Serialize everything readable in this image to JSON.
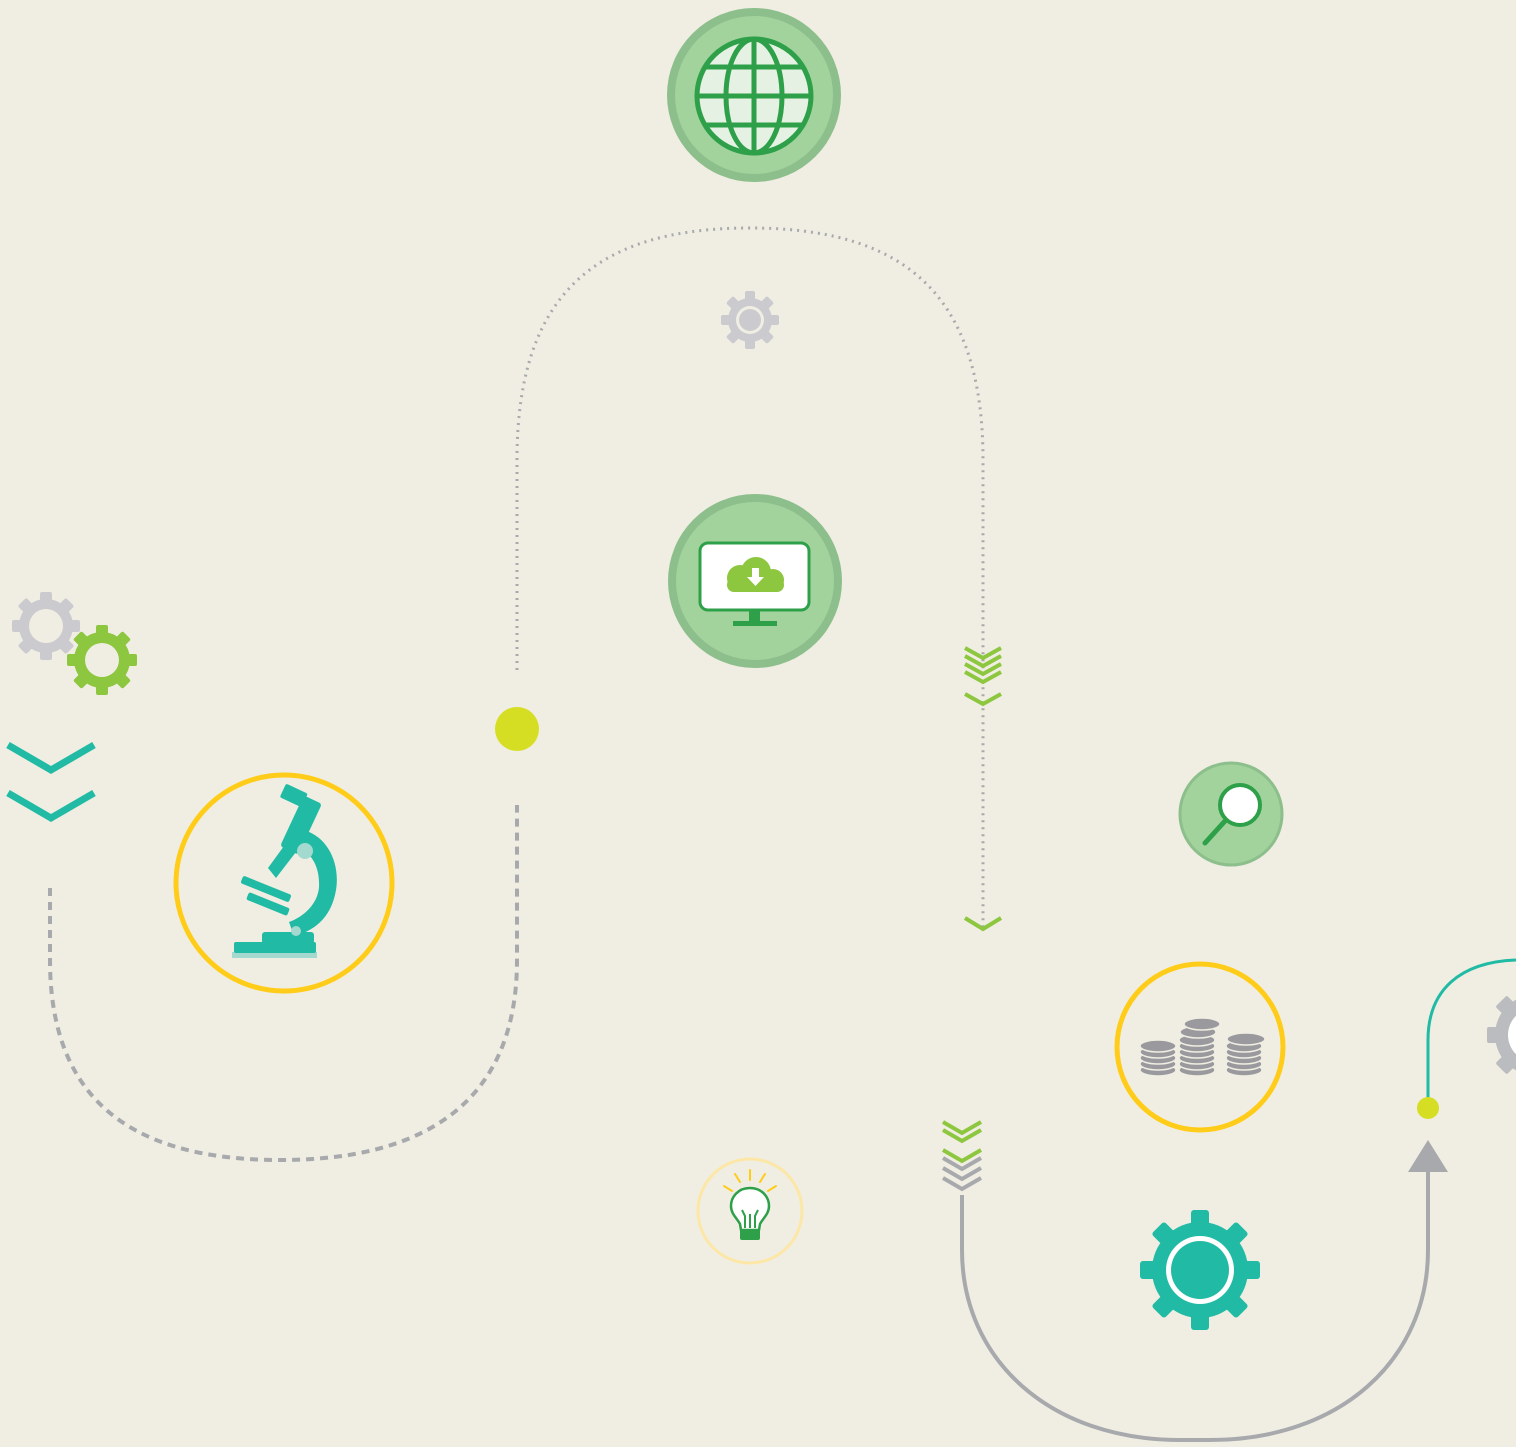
{
  "colors": {
    "background": "#F0EEE2",
    "pale_green": "#A3D39C",
    "ring_green": "#8CBF8C",
    "dark_green": "#2EA04A",
    "lime": "#8DC63F",
    "teal": "#21BBA5",
    "yellow": "#FFCC1A",
    "pale_yellow": "#FCE7A7",
    "yellow_green_dot": "#D6DE23",
    "light_gray": "#CBCBCF",
    "mid_gray": "#A7A9AC",
    "dark_gray": "#9A9A9E"
  },
  "icons": [
    "globe-icon",
    "gear-icon",
    "cloud-download-monitor-icon",
    "gears-icon",
    "chevrons-down-icon",
    "microscope-icon",
    "magnifier-icon",
    "coins-icon",
    "lightbulb-icon",
    "arrow-up-icon"
  ]
}
